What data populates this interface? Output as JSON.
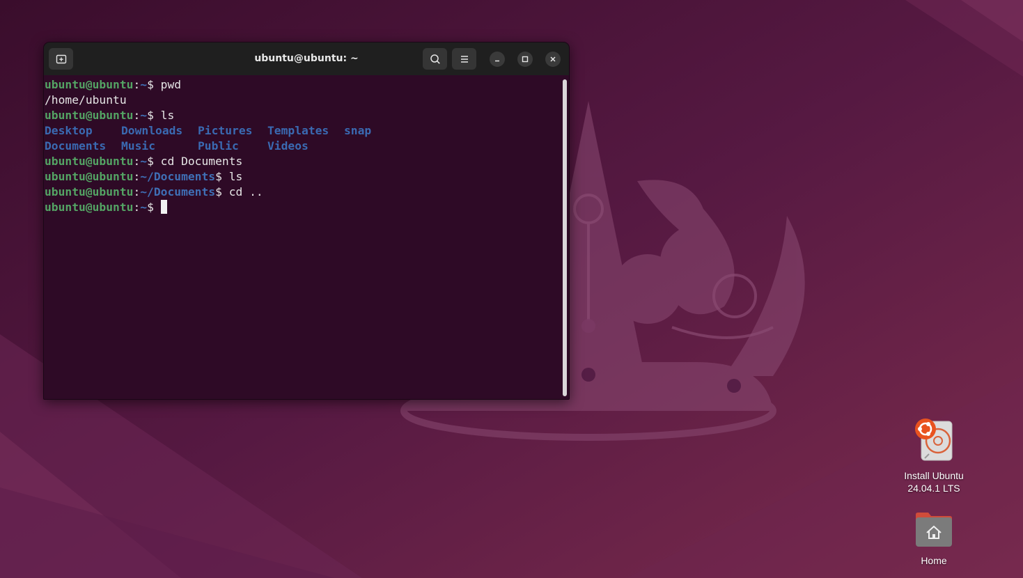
{
  "terminal": {
    "title": "ubuntu@ubuntu: ~",
    "lines": [
      {
        "user": "ubuntu@ubuntu",
        "sep": ":",
        "path": "~",
        "prompt": "$ ",
        "cmd": "pwd"
      },
      {
        "output": "/home/ubuntu"
      },
      {
        "user": "ubuntu@ubuntu",
        "sep": ":",
        "path": "~",
        "prompt": "$ ",
        "cmd": "ls"
      },
      {
        "dirs": [
          "Desktop",
          "Downloads",
          "Pictures",
          "Templates",
          "snap"
        ]
      },
      {
        "dirs": [
          "Documents",
          "Music",
          "Public",
          "Videos"
        ]
      },
      {
        "user": "ubuntu@ubuntu",
        "sep": ":",
        "path": "~",
        "prompt": "$ ",
        "cmd": "cd Documents"
      },
      {
        "user": "ubuntu@ubuntu",
        "sep": ":",
        "path": "~/Documents",
        "prompt": "$ ",
        "cmd": "ls"
      },
      {
        "user": "ubuntu@ubuntu",
        "sep": ":",
        "path": "~/Documents",
        "prompt": "$ ",
        "cmd": "cd .."
      },
      {
        "user": "ubuntu@ubuntu",
        "sep": ":",
        "path": "~",
        "prompt": "$ ",
        "cmd": ""
      }
    ],
    "buttons": {
      "new_tab": "new-tab-icon",
      "search": "search-icon",
      "menu": "hamburger-menu-icon",
      "minimize": "minimize-icon",
      "maximize": "maximize-icon",
      "close": "close-icon"
    }
  },
  "desktop": {
    "icons": [
      {
        "label_line1": "Install Ubuntu",
        "label_line2": "24.04.1 LTS",
        "icon": "ubuntu-installer-icon"
      },
      {
        "label_line1": "Home",
        "icon": "home-folder-icon"
      }
    ]
  },
  "colors": {
    "terminal_bg": "#2e0a26",
    "user_green": "#54a464",
    "path_blue": "#3f6fb5",
    "titlebar": "#1f1f1f"
  }
}
